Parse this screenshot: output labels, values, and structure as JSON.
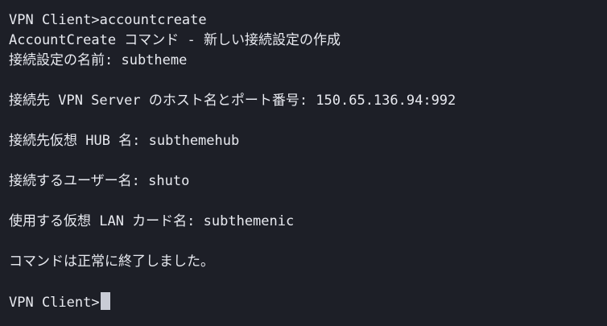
{
  "terminal": {
    "lines": [
      "VPN Client>accountcreate",
      "AccountCreate コマンド - 新しい接続設定の作成",
      "接続設定の名前: subtheme",
      "",
      "接続先 VPN Server のホスト名とポート番号: 150.65.136.94:992",
      "",
      "接続先仮想 HUB 名: subthemehub",
      "",
      "接続するユーザー名: shuto",
      "",
      "使用する仮想 LAN カード名: subthemenic",
      "",
      "コマンドは正常に終了しました。",
      ""
    ],
    "prompt": "VPN Client>",
    "input_value": ""
  },
  "colors": {
    "background": "#1d1f27",
    "foreground": "#e8eaf0",
    "cursor": "#c9ccd6"
  }
}
